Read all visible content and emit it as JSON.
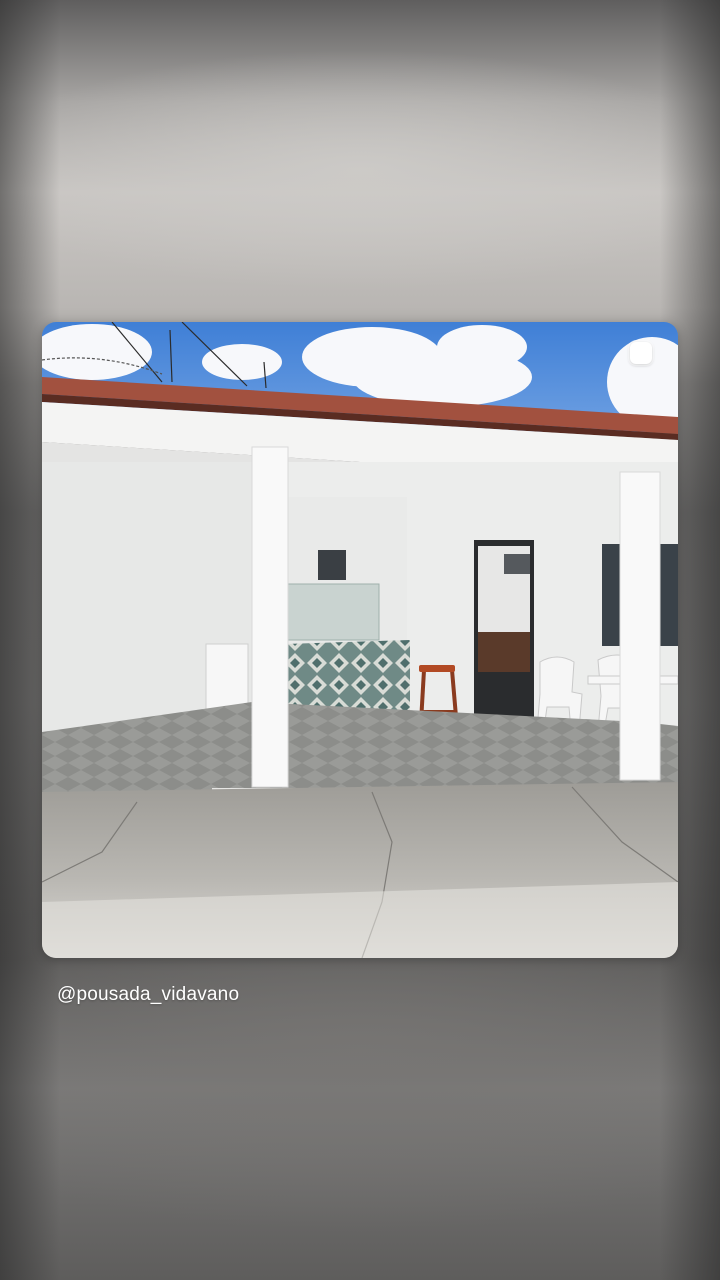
{
  "story": {
    "username": "@pousada_vidavano",
    "photo_subject": "pousada-patio-photo"
  },
  "colors": {
    "sky": "#4a86d9",
    "wall": "#f2f2f1",
    "roof_tiles": "#9c4c3c",
    "floor_tiles": "#8e8e8a",
    "concrete": "#b7b5b1"
  }
}
